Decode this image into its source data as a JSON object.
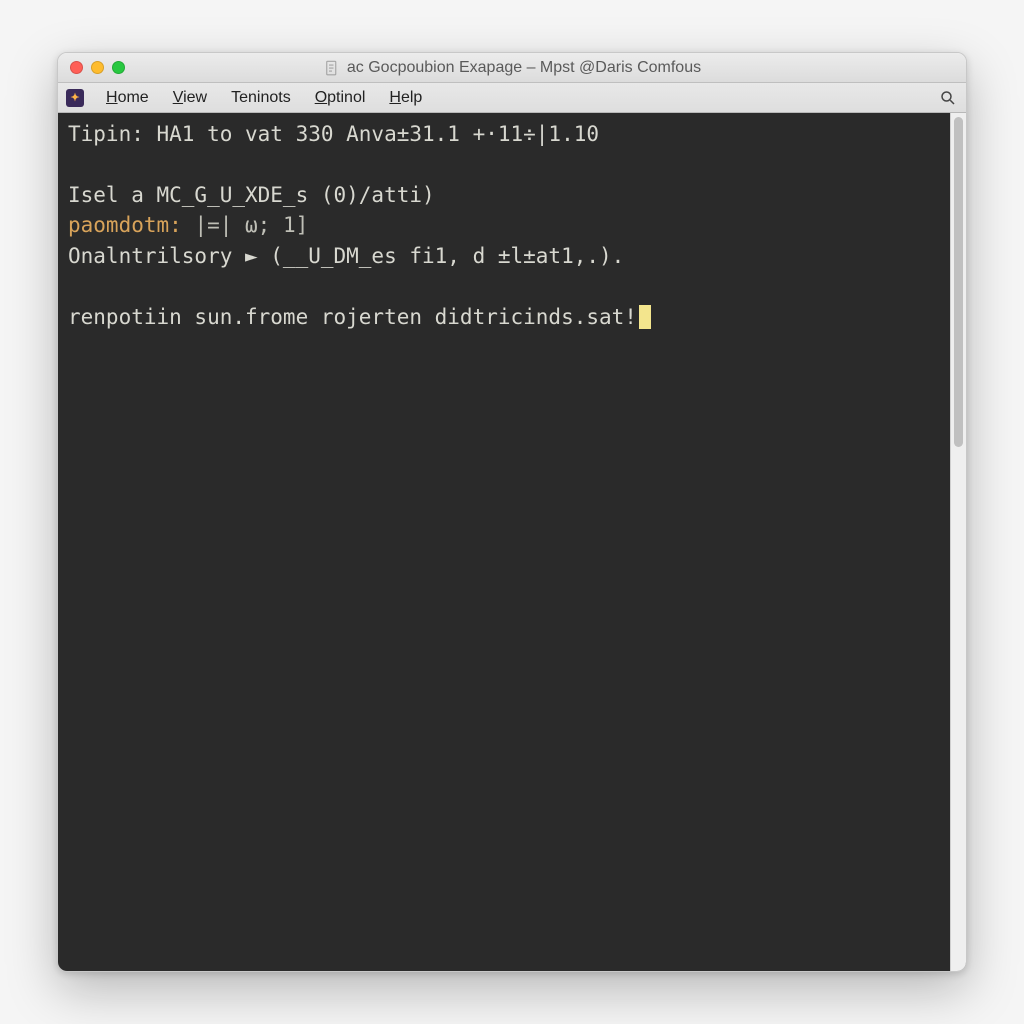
{
  "titlebar": {
    "title": "ac Gocpoubion Exapage – Mpst @Daris Comfous"
  },
  "menubar": {
    "app_icon_glyph": "✦",
    "items": [
      {
        "label": "Home",
        "accel_index": 0
      },
      {
        "label": "View",
        "accel_index": 0
      },
      {
        "label": "Teninots",
        "accel_index": -1
      },
      {
        "label": "Optinol",
        "accel_index": 0
      },
      {
        "label": "Help",
        "accel_index": 0
      }
    ]
  },
  "terminal": {
    "lines": [
      {
        "segments": [
          {
            "text": "Tipin: HA1 to vat 330 Anva±31.1 +·11÷|1.10",
            "cls": ""
          }
        ]
      },
      {
        "blank": true
      },
      {
        "segments": [
          {
            "text": "Isel a MC̲G_U̲XDE̲s (0)/atti)",
            "cls": ""
          }
        ]
      },
      {
        "segments": [
          {
            "text": "paomdotm:",
            "cls": "orange"
          },
          {
            "text": " |=| ω; 1]",
            "cls": "dim"
          }
        ]
      },
      {
        "segments": [
          {
            "text": "Onalntrilsory ► (__U̲DM̲es fi1, d ±l±at1,.).",
            "cls": ""
          }
        ]
      },
      {
        "blank": true
      },
      {
        "segments": [
          {
            "text": "renpotiin sun.frome rojerten didtricinds.sat!",
            "cls": ""
          }
        ],
        "cursor": true
      }
    ]
  }
}
